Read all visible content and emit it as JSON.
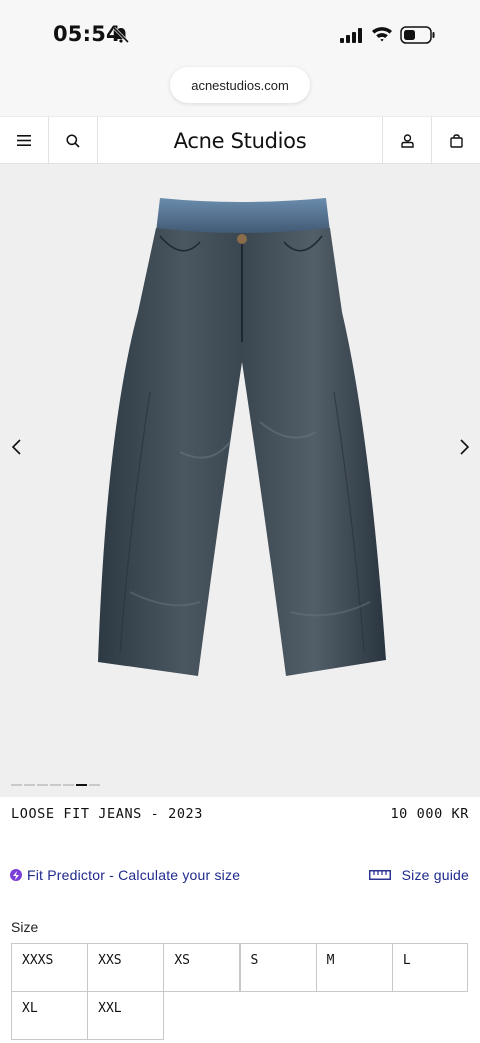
{
  "status": {
    "time": "05:54"
  },
  "browser": {
    "url": "acnestudios.com"
  },
  "header": {
    "brand": "Acne Studios"
  },
  "product": {
    "title": "LOOSE FIT JEANS - 2023",
    "price": "10 000 KR",
    "gallery": {
      "total_images": 7,
      "active_index": 5
    }
  },
  "fit_predictor": {
    "label": "Fit Predictor - Calculate your size"
  },
  "size_guide": {
    "label": "Size guide"
  },
  "sizes": {
    "label": "Size",
    "options": [
      "XXXS",
      "XXS",
      "XS",
      "S",
      "M",
      "L",
      "XL",
      "XXL"
    ]
  },
  "colors": {
    "link": "#1f2a8c",
    "fit_icon": "#7a3fd6",
    "gallery_bg": "#efefef"
  }
}
